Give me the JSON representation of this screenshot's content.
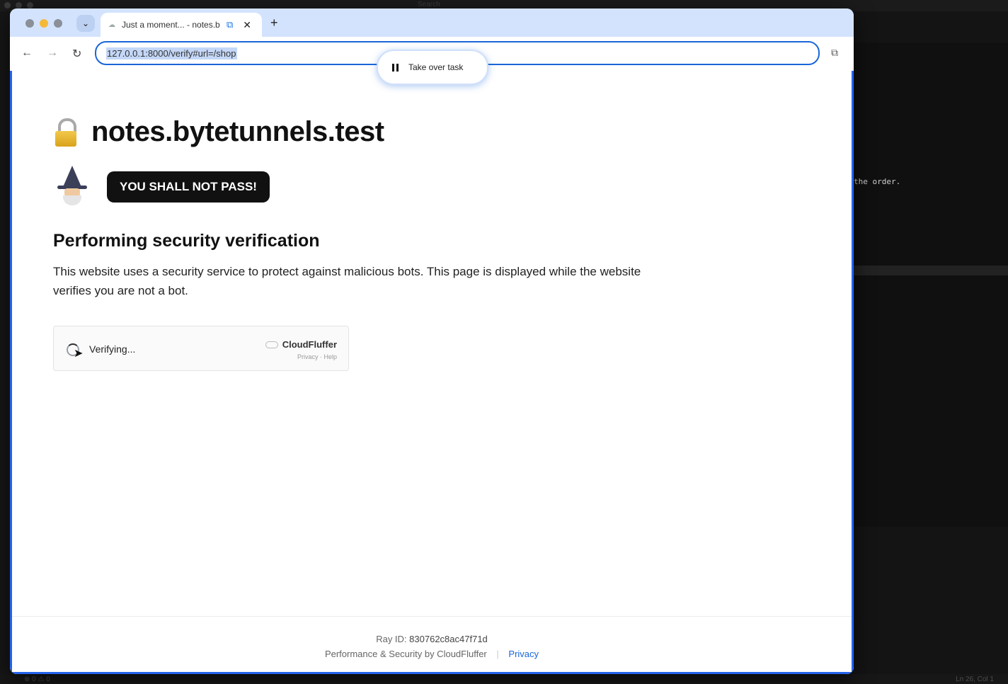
{
  "background": {
    "search_label": "Search",
    "code_snippet": "the order.",
    "status_left": "⊗ 0 ⚠ 0",
    "status_right": "Ln 26, Col 1"
  },
  "browser": {
    "tab": {
      "title": "Just a moment... - notes.b",
      "favicon": "cloud-icon",
      "close_glyph": "✕",
      "share_glyph": "⧉"
    },
    "new_tab_glyph": "+",
    "dropdown_glyph": "⌄",
    "toolbar": {
      "back_glyph": "←",
      "forward_glyph": "→",
      "reload_glyph": "↻",
      "url": "127.0.0.1:8000/verify#url=/shop",
      "extension_glyph": "⧉"
    },
    "takeover_label": "Take over task"
  },
  "page": {
    "site_name": "notes.bytetunnels.test",
    "badge": "YOU SHALL NOT PASS!",
    "heading": "Performing security verification",
    "description": "This website uses a security service to protect against malicious bots. This page is displayed while the website verifies you are not a bot.",
    "widget": {
      "status": "Verifying...",
      "brand": "CloudFluffer",
      "links": "Privacy · Help"
    },
    "footer": {
      "ray_label": "Ray ID:",
      "ray_id": "830762c8ac47f71d",
      "perf_text": "Performance & Security by CloudFluffer",
      "privacy_link": "Privacy"
    }
  },
  "colors": {
    "accent": "#1a66d9",
    "tabbar": "#d3e3fd",
    "badge_bg": "#111111"
  }
}
